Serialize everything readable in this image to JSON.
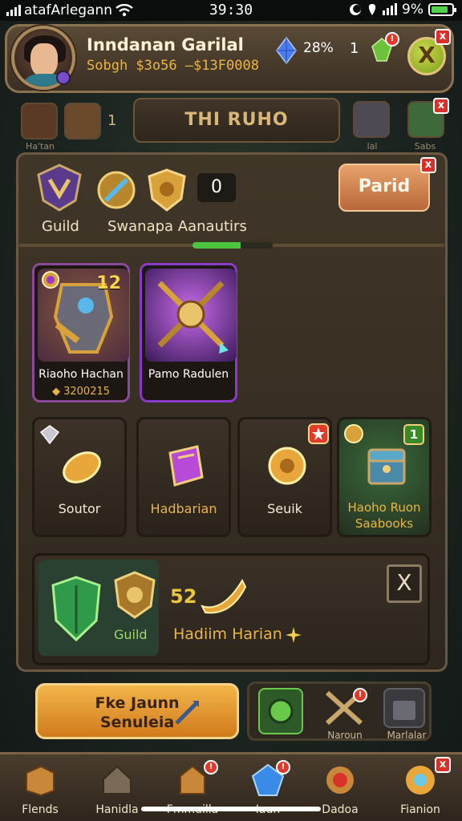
{
  "status": {
    "carrier": "atafArlegann",
    "time": "39:30",
    "battery": "9%"
  },
  "header": {
    "player_name": "Inndanan Garilal",
    "player_sub": "Sobgh $3o56 –$13F0008",
    "gem_pct": "28%",
    "gem_count": "1",
    "green_gem_badge": "!",
    "close_label": "X",
    "corner_close": "x"
  },
  "nav": {
    "left_label_1": "Ha'tan",
    "level_badge": "1",
    "title": "THI RUHO",
    "right_label_1": "lal",
    "right_label_2": "Sabs"
  },
  "panel": {
    "emblem_label": "Guild",
    "secondary_label": "Swanapa Aanautirs",
    "score": "0",
    "action_label": "Parid",
    "progress": 0.6
  },
  "heroes": [
    {
      "level": "12",
      "name": "Riaoho Hachan",
      "sub": "◆ 3200215"
    },
    {
      "level": "",
      "name": "Pamo Radulen",
      "sub": ""
    }
  ],
  "items": [
    {
      "label": "Soutor",
      "color": "#f4ead4"
    },
    {
      "label": "Hadbarian",
      "color": "#e9b645"
    },
    {
      "label": "Seuik",
      "color": "#f4ead4"
    },
    {
      "label": "Haoho Ruon Saabooks",
      "color": "#e9b645",
      "badge": "1"
    }
  ],
  "guild_strip": {
    "emblem_label": "Guild",
    "amount": "52",
    "reward_label": "Hadiim Harian",
    "dismiss": "X"
  },
  "cta": {
    "line1": "Fke Jaunn",
    "line2": "Senuleia"
  },
  "mini_rack": {
    "labels": [
      "Naroun",
      "Marlalar"
    ]
  },
  "tabs": [
    {
      "label": "Flends"
    },
    {
      "label": "Hanidla"
    },
    {
      "label": "Fmmuilla"
    },
    {
      "label": "Iaun"
    },
    {
      "label": "Dadoa"
    },
    {
      "label": "Fianion"
    }
  ]
}
